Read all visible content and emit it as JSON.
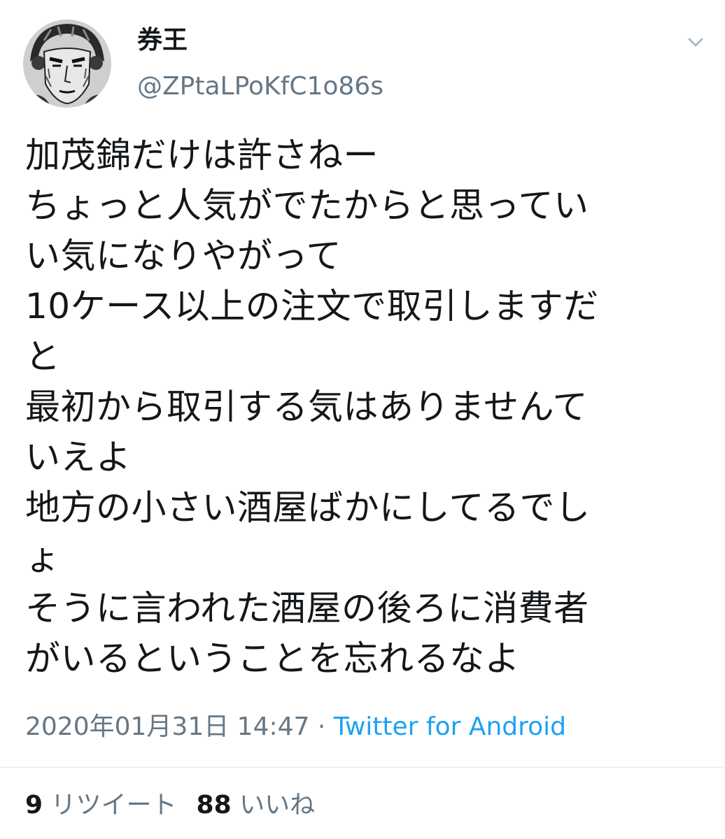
{
  "user": {
    "display_name": "券王",
    "handle": "@ZPtaLPoKfC1o86s",
    "avatar_icon": "manga-portrait-avatar"
  },
  "tweet": {
    "lines": [
      "加茂錦だけは許さねー",
      "ちょっと人気がでたからと思ってい",
      "い気になりやがって",
      "10ケース以上の注文で取引しますだ",
      "と",
      "最初から取引する気はありませんて",
      "いえよ",
      "地方の小さい酒屋ばかにしてるでし",
      "ょ",
      "そうに言われた酒屋の後ろに消費者",
      "がいるということを忘れるなよ"
    ]
  },
  "meta": {
    "timestamp": "2020年01月31日 14:47",
    "separator": "·",
    "source": "Twitter for Android"
  },
  "stats": {
    "retweets_count": "9",
    "retweets_label": "リツイート",
    "likes_count": "88",
    "likes_label": "いいね"
  },
  "colors": {
    "text": "#14171a",
    "secondary": "#657786",
    "link": "#1da1f2"
  }
}
